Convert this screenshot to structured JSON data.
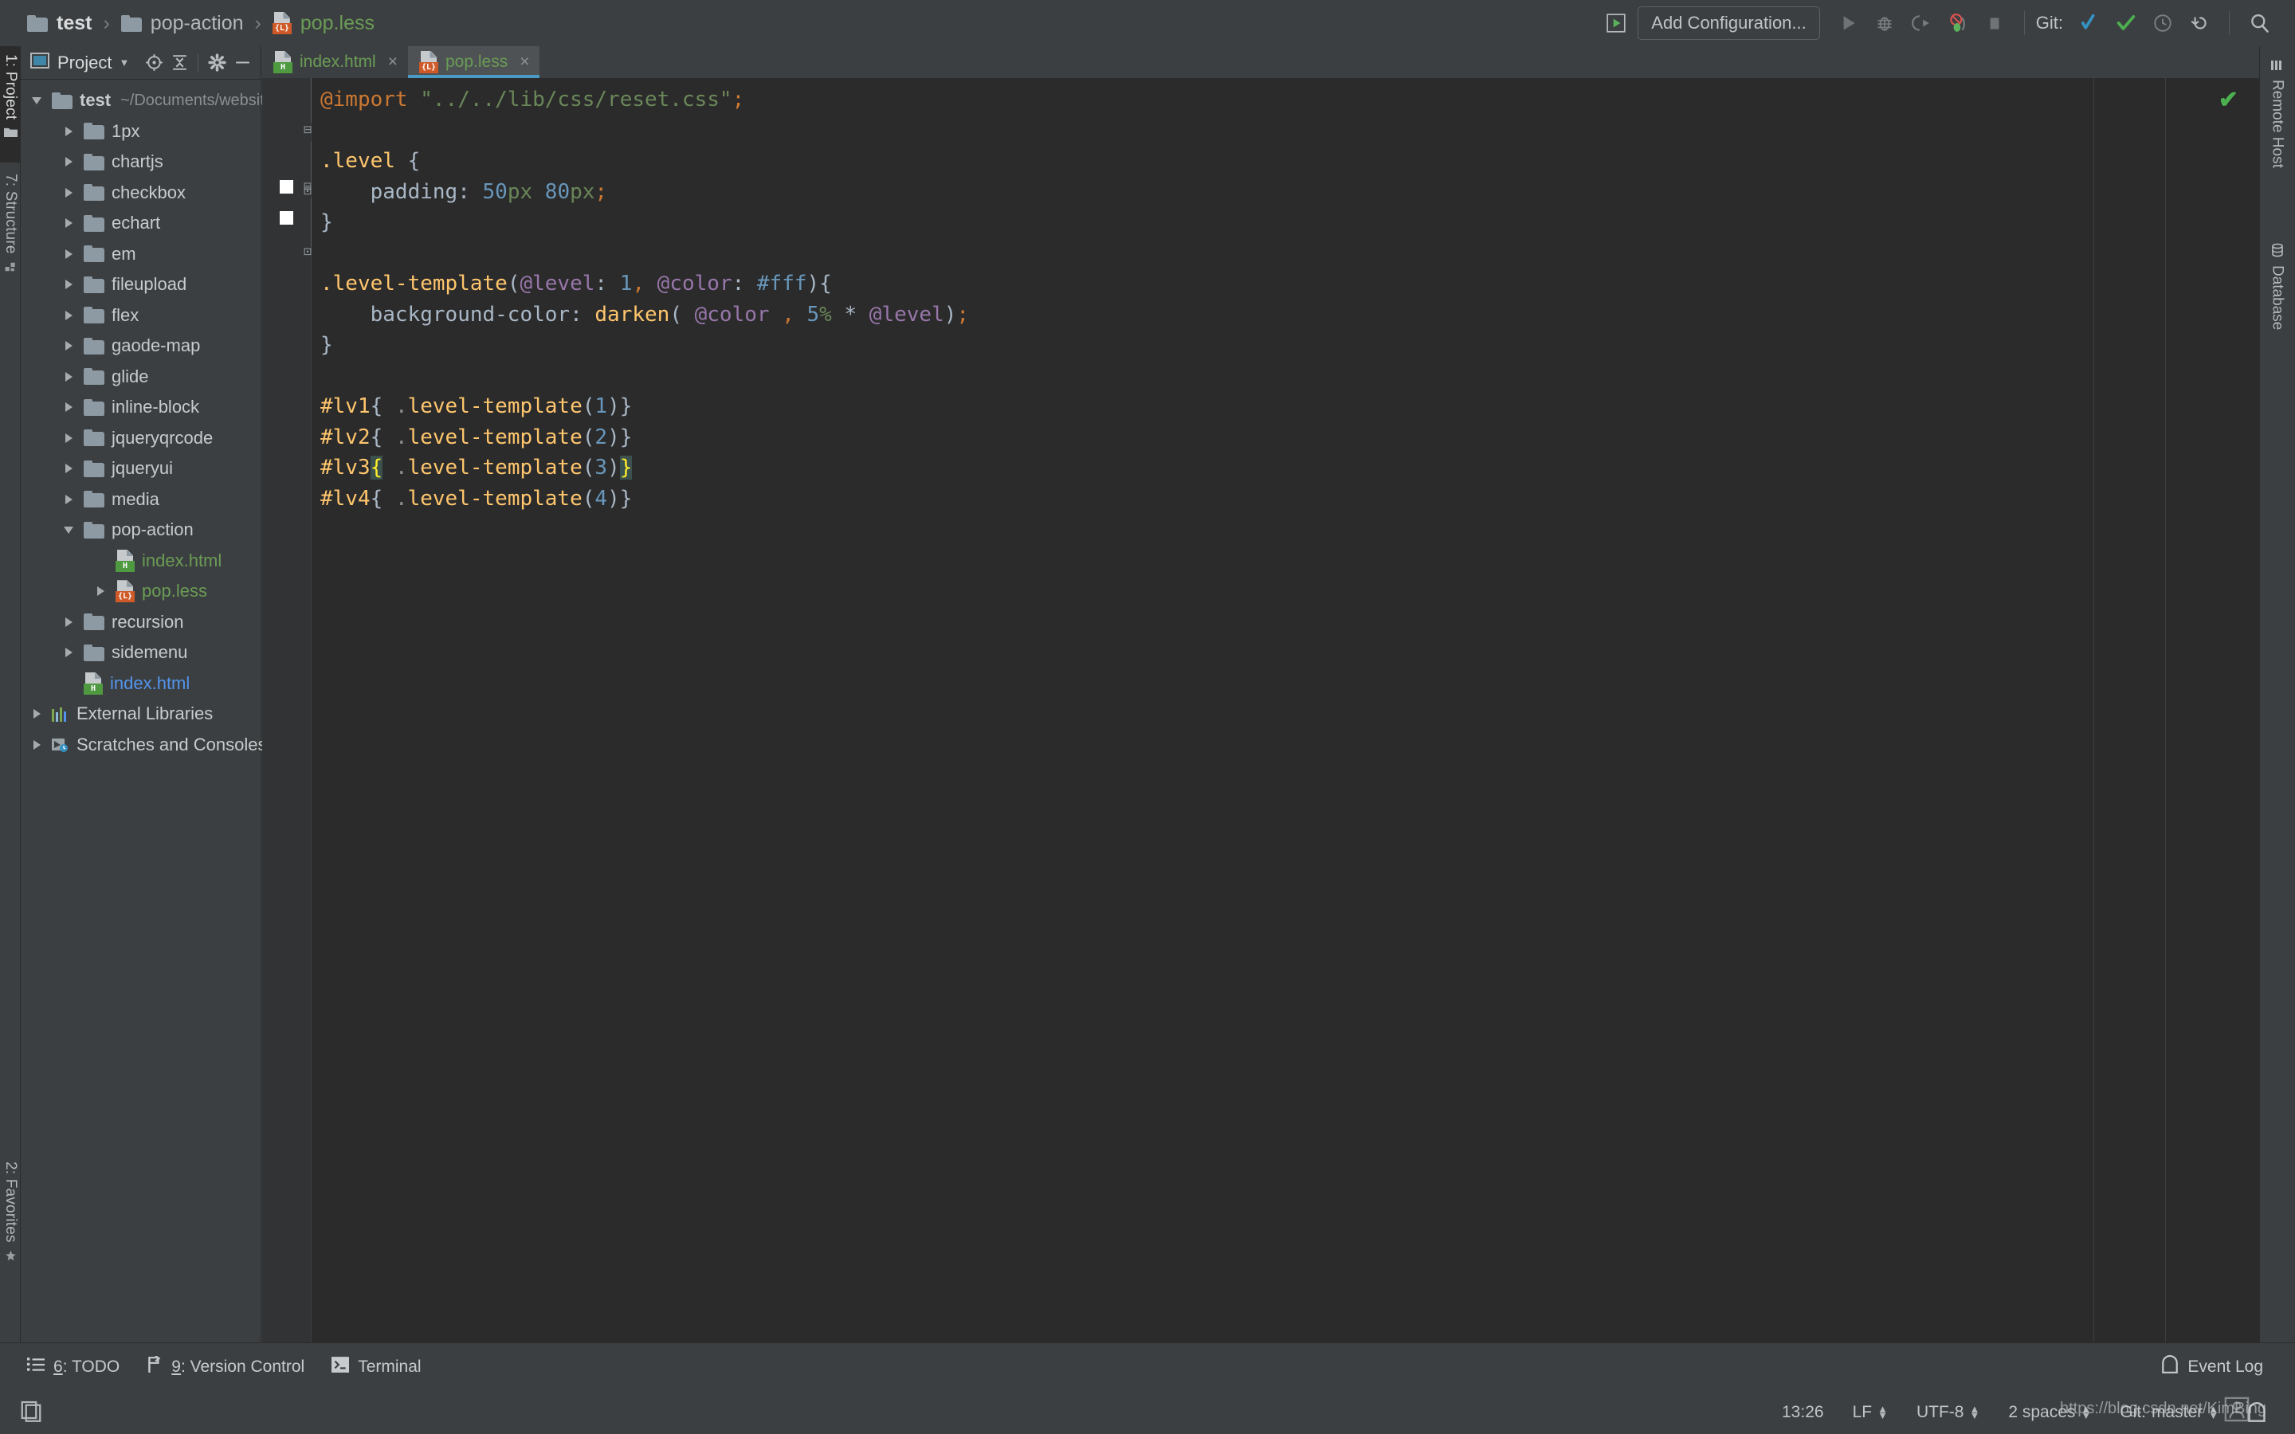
{
  "breadcrumb": {
    "items": [
      {
        "label": "test",
        "type": "folder"
      },
      {
        "label": "pop-action",
        "type": "folder"
      },
      {
        "label": "pop.less",
        "type": "less-file"
      }
    ],
    "separator": "›"
  },
  "toolbar": {
    "add_configuration": "Add Configuration...",
    "git_label": "Git:",
    "icons": [
      "run-widget-icon",
      "run-icon",
      "debug-icon",
      "run-with-coverage-icon",
      "profiler-icon",
      "stop-icon",
      "git-update-icon",
      "git-commit-icon",
      "git-history-icon",
      "git-rollback-icon",
      "search-everywhere-icon"
    ]
  },
  "left_tool_window_tabs": [
    {
      "label": "1: Project",
      "active": true,
      "icon": "folder-icon"
    },
    {
      "label": "7: Structure",
      "active": false,
      "icon": "structure-icon"
    },
    {
      "label": "2: Favorites",
      "active": false,
      "icon": "star-icon"
    }
  ],
  "right_tool_window_tabs": [
    {
      "label": "Remote Host",
      "icon": "remote-host-icon"
    },
    {
      "label": "Database",
      "icon": "database-icon"
    }
  ],
  "project_panel": {
    "title": "Project",
    "tools": [
      "locate-icon",
      "collapse-all-icon",
      "settings-gear-icon",
      "hide-icon"
    ],
    "tree": [
      {
        "indent": 0,
        "arrow": "down",
        "icon": "folder",
        "label": "test",
        "path": "~/Documents/website/test",
        "bold": true
      },
      {
        "indent": 1,
        "arrow": "right",
        "icon": "folder",
        "label": "1px"
      },
      {
        "indent": 1,
        "arrow": "right",
        "icon": "folder",
        "label": "chartjs"
      },
      {
        "indent": 1,
        "arrow": "right",
        "icon": "folder",
        "label": "checkbox"
      },
      {
        "indent": 1,
        "arrow": "right",
        "icon": "folder",
        "label": "echart"
      },
      {
        "indent": 1,
        "arrow": "right",
        "icon": "folder",
        "label": "em"
      },
      {
        "indent": 1,
        "arrow": "right",
        "icon": "folder",
        "label": "fileupload"
      },
      {
        "indent": 1,
        "arrow": "right",
        "icon": "folder",
        "label": "flex"
      },
      {
        "indent": 1,
        "arrow": "right",
        "icon": "folder",
        "label": "gaode-map"
      },
      {
        "indent": 1,
        "arrow": "right",
        "icon": "folder",
        "label": "glide"
      },
      {
        "indent": 1,
        "arrow": "right",
        "icon": "folder",
        "label": "inline-block"
      },
      {
        "indent": 1,
        "arrow": "right",
        "icon": "folder",
        "label": "jqueryqrcode"
      },
      {
        "indent": 1,
        "arrow": "right",
        "icon": "folder",
        "label": "jqueryui"
      },
      {
        "indent": 1,
        "arrow": "right",
        "icon": "folder",
        "label": "media"
      },
      {
        "indent": 1,
        "arrow": "down",
        "icon": "folder",
        "label": "pop-action"
      },
      {
        "indent": 2,
        "arrow": "none",
        "icon": "html",
        "label": "index.html",
        "color": "green"
      },
      {
        "indent": 2,
        "arrow": "right",
        "icon": "less",
        "label": "pop.less",
        "color": "green"
      },
      {
        "indent": 1,
        "arrow": "right",
        "icon": "folder",
        "label": "recursion"
      },
      {
        "indent": 1,
        "arrow": "right",
        "icon": "folder",
        "label": "sidemenu"
      },
      {
        "indent": 1,
        "arrow": "none",
        "icon": "html",
        "label": "index.html",
        "color": "blue"
      },
      {
        "indent": 0,
        "arrow": "right",
        "icon": "libs",
        "label": "External Libraries"
      },
      {
        "indent": 0,
        "arrow": "right",
        "icon": "scratch",
        "label": "Scratches and Consoles"
      }
    ]
  },
  "editor": {
    "tabs": [
      {
        "label": "index.html",
        "icon": "html",
        "active": false,
        "close": "×"
      },
      {
        "label": "pop.less",
        "icon": "less",
        "active": true,
        "close": "×"
      }
    ],
    "inspection_status": "ok-check-icon",
    "current_line_index": 8,
    "lines": [
      "@import \"../../lib/css/reset.css\";",
      "",
      ".level {",
      "    padding: 50px 80px;",
      "}",
      "",
      ".level-template(@level: 1, @color: #fff){",
      "    background-color: darken( @color , 5% * @level);",
      "}",
      "",
      "#lv1{ .level-template(1)}",
      "#lv2{ .level-template(2)}",
      "#lv3{ .level-template(3)}",
      "#lv4{ .level-template(4)}"
    ]
  },
  "bottom_bar": {
    "buttons": [
      {
        "key": "6",
        "label": ": TODO",
        "icon": "todo-icon"
      },
      {
        "key": "9",
        "label": ": Version Control",
        "icon": "vcs-icon"
      },
      {
        "key": "",
        "label": "Terminal",
        "icon": "terminal-icon"
      }
    ],
    "event_log": "Event Log"
  },
  "status_bar": {
    "position": "13:26",
    "line_separator": "LF",
    "encoding": "UTF-8",
    "indent": "2 spaces",
    "git_branch_label": "Git:",
    "git_branch": "master"
  },
  "watermark": "https://blog.csdn.net/KimBing",
  "colors": {
    "panel_bg": "#3c3f41",
    "editor_bg": "#2b2b2b",
    "gutter_bg": "#313335",
    "accent_tab": "#4a9bc4",
    "green_file": "#6a9c55",
    "blue_file": "#5394ec",
    "selector": "#ffc66d",
    "keyword": "#cc7832",
    "string": "#6a8759",
    "number": "#6897bb",
    "variable": "#9876aa",
    "brace_match": "#ffef28"
  }
}
